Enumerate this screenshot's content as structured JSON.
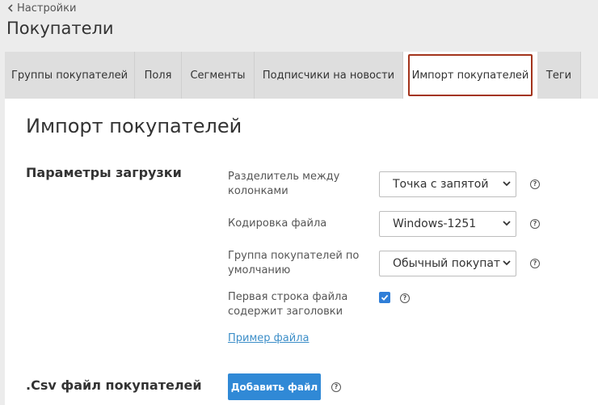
{
  "header": {
    "back_label": "Настройки",
    "page_title": "Покупатели"
  },
  "tabs": [
    {
      "label": "Группы покупателей"
    },
    {
      "label": "Поля"
    },
    {
      "label": "Сегменты"
    },
    {
      "label": "Подписчики на новости"
    },
    {
      "label": "Импорт покупателей",
      "active": true
    },
    {
      "label": "Теги"
    }
  ],
  "main": {
    "section_title": "Импорт покупателей",
    "params_title": "Параметры загрузки",
    "fields": {
      "delimiter_label": "Разделитель между колонками",
      "delimiter_value": "Точка с запятой",
      "encoding_label": "Кодировка файла",
      "encoding_value": "Windows-1251",
      "group_label": "Группа покупателей по умолчанию",
      "group_value": "Обычный покупатель",
      "header_row_label": "Первая строка файла содержит заголовки",
      "header_row_checked": true
    },
    "help_glyph": "?",
    "sample_link": "Пример файла",
    "csv_title": ".Csv файл покупателей",
    "add_file_button": "Добавить файл"
  },
  "colors": {
    "accent": "#3089d6",
    "active_tab_border": "#a3341c",
    "link": "#3c8ec8"
  }
}
